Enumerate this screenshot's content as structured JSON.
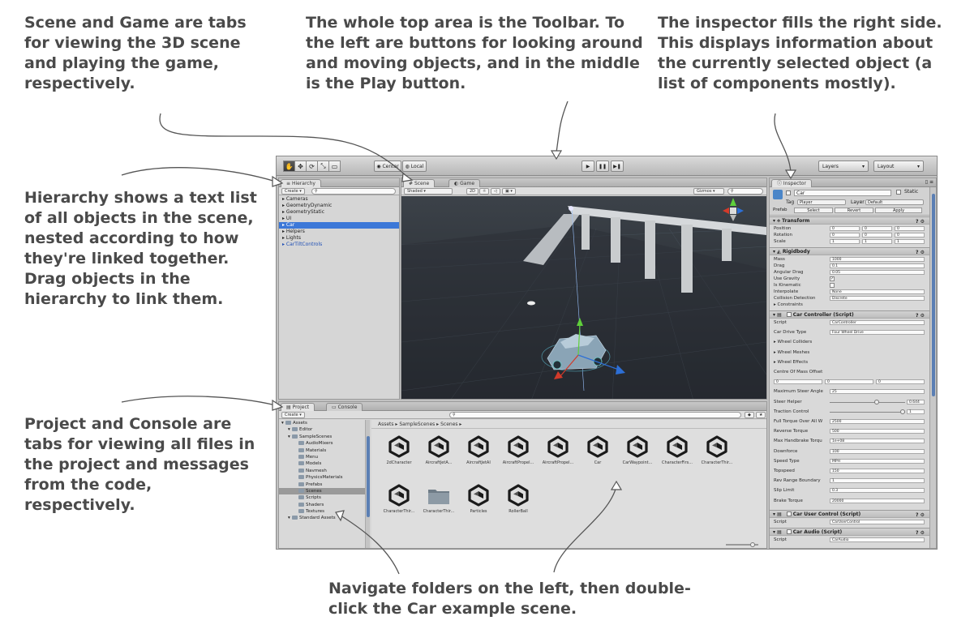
{
  "callouts": {
    "scene_game": "Scene and Game are tabs for viewing the 3D scene and playing the game, respectively.",
    "toolbar": "The whole top area is the Toolbar. To the left are buttons for looking around and moving objects, and in the middle is the Play button.",
    "inspector": "The inspector fills the right side. This displays information about the currently selected object (a list of components mostly).",
    "hierarchy": "Hierarchy shows a text list of all objects in the scene, nested according to how they're linked together. Drag objects in the hierarchy to link them.",
    "project_console": "Project and Console are tabs for viewing all files in the project and messages from the code, respectively.",
    "navigate": "Navigate folders on the left, then double-click the Car example scene."
  },
  "toolbar": {
    "tools": [
      "hand-icon",
      "move-icon",
      "rotate-icon",
      "scale-icon",
      "rect-icon"
    ],
    "pivot_label": "Center",
    "space_label": "Local",
    "layers_label": "Layers",
    "layout_label": "Layout"
  },
  "hierarchy": {
    "tab": "Hierarchy",
    "create_label": "Create",
    "items": [
      {
        "label": "Cameras",
        "type": "normal"
      },
      {
        "label": "GeometryDynamic",
        "type": "normal"
      },
      {
        "label": "GeometryStatic",
        "type": "normal"
      },
      {
        "label": "UI",
        "type": "normal"
      },
      {
        "label": "Car",
        "type": "selected"
      },
      {
        "label": "Helpers",
        "type": "normal"
      },
      {
        "label": "Lights",
        "type": "normal"
      },
      {
        "label": "CarTiltControls",
        "type": "prefab"
      }
    ]
  },
  "scene": {
    "tab_scene": "Scene",
    "tab_game": "Game",
    "shading": "Shaded",
    "mode_2d": "2D",
    "gizmos": "Gizmos",
    "persp": "< Persp"
  },
  "project": {
    "tab_project": "Project",
    "tab_console": "Console",
    "create_label": "Create",
    "breadcrumb": "Assets ▸ SampleScenes ▸ Scenes ▸",
    "tree": [
      {
        "label": "Assets",
        "indent": 0
      },
      {
        "label": "Editor",
        "indent": 1
      },
      {
        "label": "SampleScenes",
        "indent": 1
      },
      {
        "label": "AudioMixers",
        "indent": 2
      },
      {
        "label": "Materials",
        "indent": 2
      },
      {
        "label": "Menu",
        "indent": 2
      },
      {
        "label": "Models",
        "indent": 2
      },
      {
        "label": "Navmesh",
        "indent": 2
      },
      {
        "label": "PhysicsMaterials",
        "indent": 2
      },
      {
        "label": "Prefabs",
        "indent": 2
      },
      {
        "label": "Scenes",
        "indent": 2,
        "selected": true
      },
      {
        "label": "Scripts",
        "indent": 2
      },
      {
        "label": "Shaders",
        "indent": 2
      },
      {
        "label": "Textures",
        "indent": 2
      },
      {
        "label": "Standard Assets",
        "indent": 1
      }
    ],
    "assets": [
      {
        "label": "2dCharacter",
        "kind": "unity"
      },
      {
        "label": "AircraftJetA...",
        "kind": "unity"
      },
      {
        "label": "AircraftJetAI",
        "kind": "unity"
      },
      {
        "label": "AircraftPropel...",
        "kind": "unity"
      },
      {
        "label": "AircraftPropel...",
        "kind": "unity"
      },
      {
        "label": "Car",
        "kind": "unity"
      },
      {
        "label": "CarWaypoint...",
        "kind": "unity"
      },
      {
        "label": "CharacterFirs...",
        "kind": "unity"
      },
      {
        "label": "CharacterThir...",
        "kind": "unity"
      },
      {
        "label": "CharacterThir...",
        "kind": "unity"
      },
      {
        "label": "CharacterThir...",
        "kind": "folder"
      },
      {
        "label": "Particles",
        "kind": "unity"
      },
      {
        "label": "RollerBall",
        "kind": "unity"
      }
    ]
  },
  "inspector": {
    "tab": "Inspector",
    "object_name": "Car",
    "static_label": "Static",
    "tag_label": "Tag",
    "tag_value": "Player",
    "layer_label": "Layer",
    "layer_value": "Default",
    "prefab_label": "Prefab",
    "select_label": "Select",
    "revert_label": "Revert",
    "apply_label": "Apply",
    "transform": {
      "title": "Transform",
      "position": {
        "label": "Position",
        "x": "0",
        "y": "0",
        "z": "0"
      },
      "rotation": {
        "label": "Rotation",
        "x": "0",
        "y": "0",
        "z": "0"
      },
      "scale": {
        "label": "Scale",
        "x": "1",
        "y": "1",
        "z": "1"
      }
    },
    "rigidbody": {
      "title": "Rigidbody",
      "mass": {
        "label": "Mass",
        "value": "1000"
      },
      "drag": {
        "label": "Drag",
        "value": "0.1"
      },
      "angular_drag": {
        "label": "Angular Drag",
        "value": "0.05"
      },
      "use_gravity": {
        "label": "Use Gravity"
      },
      "is_kinematic": {
        "label": "Is Kinematic"
      },
      "interpolate": {
        "label": "Interpolate",
        "value": "None"
      },
      "collision": {
        "label": "Collision Detection",
        "value": "Discrete"
      },
      "constraints": {
        "label": "Constraints"
      }
    },
    "car_controller": {
      "title": "Car Controller (Script)",
      "script": {
        "label": "Script",
        "value": "CarController"
      },
      "drive_type": {
        "label": "Car Drive Type",
        "value": "Four Wheel Drive"
      },
      "wheel_colliders": "Wheel Colliders",
      "wheel_meshes": "Wheel Meshes",
      "wheel_effects": "Wheel Effects",
      "centre_of_mass": "Centre Of Mass Offset",
      "com": {
        "x": "0",
        "y": "0",
        "z": "0"
      },
      "max_steer": {
        "label": "Maximum Steer Angle",
        "value": "25"
      },
      "steer_helper": {
        "label": "Steer Helper",
        "value": "0.644",
        "level": 0.64
      },
      "traction": {
        "label": "Traction Control",
        "value": "1",
        "level": 1.0
      },
      "full_torque": {
        "label": "Full Torque Over All W",
        "value": "2500"
      },
      "reverse_torque": {
        "label": "Reverse Torque",
        "value": "500"
      },
      "handbrake": {
        "label": "Max Handbrake Torqu",
        "value": "1e+08"
      },
      "downforce": {
        "label": "Downforce",
        "value": "100"
      },
      "speed_type": {
        "label": "Speed Type",
        "value": "MPH"
      },
      "topspeed": {
        "label": "Topspeed",
        "value": "150"
      },
      "rev_range": {
        "label": "Rev Range Boundary",
        "value": "1"
      },
      "slip_limit": {
        "label": "Slip Limit",
        "value": "0.3"
      },
      "brake_torque": {
        "label": "Brake Torque",
        "value": "20000"
      }
    },
    "car_user_control": {
      "title": "Car User Control (Script)",
      "script": {
        "label": "Script",
        "value": "CarUserControl"
      }
    },
    "car_audio": {
      "title": "Car Audio (Script)",
      "script": {
        "label": "Script",
        "value": "CarAudio"
      }
    }
  }
}
